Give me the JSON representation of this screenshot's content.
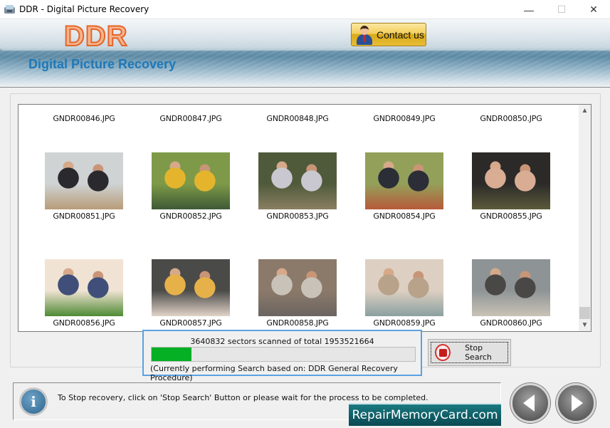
{
  "window": {
    "title": "DDR - Digital Picture Recovery",
    "minimize_glyph": "—",
    "maximize_glyph": "☐",
    "close_glyph": "✕"
  },
  "header": {
    "logo": "DDR",
    "subtitle": "Digital Picture Recovery",
    "contact_label": "Contact us"
  },
  "gallery": {
    "items": [
      {
        "name": "GNDR00846.JPG",
        "thumb": false
      },
      {
        "name": "GNDR00847.JPG",
        "thumb": false
      },
      {
        "name": "GNDR00848.JPG",
        "thumb": false
      },
      {
        "name": "GNDR00849.JPG",
        "thumb": false
      },
      {
        "name": "GNDR00850.JPG",
        "thumb": false
      },
      {
        "name": "GNDR00851.JPG",
        "thumb": true,
        "colors": [
          "#cfd3d4",
          "#2a2a2e",
          "#b89c78"
        ]
      },
      {
        "name": "GNDR00852.JPG",
        "thumb": true,
        "colors": [
          "#7e9a48",
          "#e4b52c",
          "#3e5a35"
        ]
      },
      {
        "name": "GNDR00853.JPG",
        "thumb": true,
        "colors": [
          "#4f5a3b",
          "#c9c7cf",
          "#8a7e62"
        ]
      },
      {
        "name": "GNDR00854.JPG",
        "thumb": true,
        "colors": [
          "#93a05a",
          "#2b2e36",
          "#b85a3a"
        ]
      },
      {
        "name": "GNDR00855.JPG",
        "thumb": true,
        "colors": [
          "#2c2a29",
          "#d9ad94",
          "#5b5a3a"
        ]
      },
      {
        "name": "GNDR00856.JPG",
        "thumb": true,
        "colors": [
          "#f1e3d4",
          "#3f4f7a",
          "#4f8a34"
        ]
      },
      {
        "name": "GNDR00857.JPG",
        "thumb": true,
        "colors": [
          "#4a4a48",
          "#e7b14a",
          "#e2d3c8"
        ]
      },
      {
        "name": "GNDR00858.JPG",
        "thumb": true,
        "colors": [
          "#8b7a6a",
          "#c9c2b8",
          "#6b6460"
        ]
      },
      {
        "name": "GNDR00859.JPG",
        "thumb": true,
        "colors": [
          "#ddd0c2",
          "#b8a28a",
          "#8aa0a0"
        ]
      },
      {
        "name": "GNDR00860.JPG",
        "thumb": true,
        "colors": [
          "#8e9496",
          "#4a4846",
          "#c9c2b6"
        ]
      }
    ],
    "scroll_position": 0.97
  },
  "progress": {
    "sectors_text": "3640832 sectors scanned of total 1953521664",
    "percent": 15,
    "fill_color": "#06b025",
    "procedure_text": "(Currently performing Search based on:  DDR General Recovery Procedure)"
  },
  "stop_button": {
    "label": "Stop Search"
  },
  "status": {
    "info_glyph": "i",
    "message": "To Stop recovery, click on 'Stop Search' Button or please wait for the process to be completed."
  },
  "brand": {
    "text": "RepairMemoryCard.com"
  },
  "nav": {
    "back_label": "Back",
    "next_label": "Next"
  }
}
